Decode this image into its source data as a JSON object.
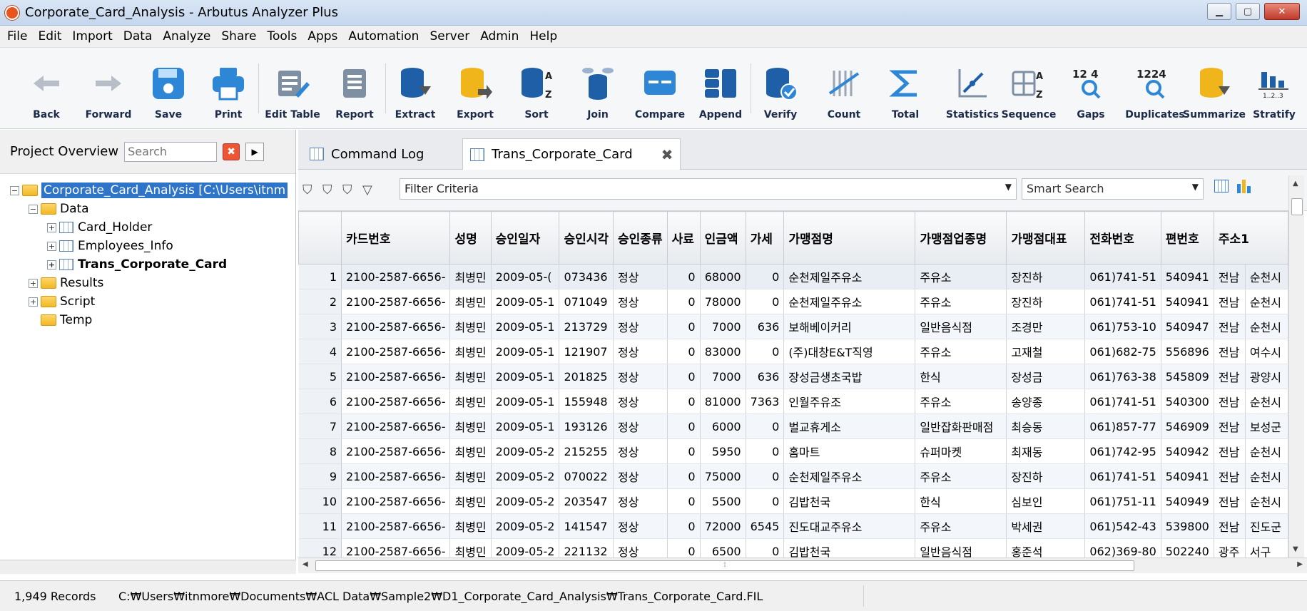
{
  "window": {
    "title": "Corporate_Card_Analysis - Arbutus Analyzer Plus"
  },
  "menu": [
    "File",
    "Edit",
    "Import",
    "Data",
    "Analyze",
    "Share",
    "Tools",
    "Apps",
    "Automation",
    "Server",
    "Admin",
    "Help"
  ],
  "toolbar": [
    "Back",
    "Forward",
    "Save",
    "Print",
    "Edit Table",
    "Report",
    "Extract",
    "Export",
    "Sort",
    "Join",
    "Compare",
    "Append",
    "Verify",
    "Count",
    "Total",
    "Statistics",
    "Sequence",
    "Gaps",
    "Duplicates",
    "Summarize",
    "Stratify"
  ],
  "toolbar_icon_text": {
    "gaps": "12 4",
    "duplicates": "1224",
    "stratify": "1..2..3",
    "sort_a": "A",
    "sort_z": "Z"
  },
  "project": {
    "title": "Project Overview",
    "search_placeholder": "Search",
    "root": "Corporate_Card_Analysis [C:\\Users\\itnm",
    "data": "Data",
    "tables": [
      "Card_Holder",
      "Employees_Info",
      "Trans_Corporate_Card"
    ],
    "folders": [
      "Results",
      "Script",
      "Temp"
    ]
  },
  "tabs": [
    "Command Log",
    "Trans_Corporate_Card"
  ],
  "filter": {
    "placeholder": "Filter Criteria",
    "smart_placeholder": "Smart Search"
  },
  "columns": [
    "카드번호",
    "성명",
    "승인일자",
    "승인시각",
    "승인종류",
    "사료",
    "인금액",
    "가세",
    "가맹점명",
    "가맹점업종명",
    "가맹점대표",
    "전화번호",
    "편번호",
    "주소1"
  ],
  "rows": [
    [
      "1",
      "2100-2587-6656-",
      "최병민",
      "2009-05-(",
      "073436",
      "정상",
      "0",
      "68000",
      "0",
      "순천제일주유소",
      "주유소",
      "장진하",
      "061)741-51",
      "540941",
      "전남",
      "순천시"
    ],
    [
      "2",
      "2100-2587-6656-",
      "최병민",
      "2009-05-1",
      "071049",
      "정상",
      "0",
      "78000",
      "0",
      "순천제일주유소",
      "주유소",
      "장진하",
      "061)741-51",
      "540941",
      "전남",
      "순천시"
    ],
    [
      "3",
      "2100-2587-6656-",
      "최병민",
      "2009-05-1",
      "213729",
      "정상",
      "0",
      "7000",
      "636",
      "보해베이커리",
      "일반음식점",
      "조경만",
      "061)753-10",
      "540947",
      "전남",
      "순천시"
    ],
    [
      "4",
      "2100-2587-6656-",
      "최병민",
      "2009-05-1",
      "121907",
      "정상",
      "0",
      "83000",
      "0",
      "(주)대창E&T직영",
      "주유소",
      "고재철",
      "061)682-75",
      "556896",
      "전남",
      "여수시"
    ],
    [
      "5",
      "2100-2587-6656-",
      "최병민",
      "2009-05-1",
      "201825",
      "정상",
      "0",
      "7000",
      "636",
      "장성금생초국밥",
      "한식",
      "장성금",
      "061)763-38",
      "545809",
      "전남",
      "광양시"
    ],
    [
      "6",
      "2100-2587-6656-",
      "최병민",
      "2009-05-1",
      "155948",
      "정상",
      "0",
      "81000",
      "7363",
      "인월주유조",
      "주유소",
      "송양종",
      "061)741-51",
      "540300",
      "전남",
      "순천시"
    ],
    [
      "7",
      "2100-2587-6656-",
      "최병민",
      "2009-05-1",
      "193126",
      "정상",
      "0",
      "6000",
      "0",
      "벌교휴게소",
      "일반잡화판매점",
      "최승동",
      "061)857-77",
      "546909",
      "전남",
      "보성군"
    ],
    [
      "8",
      "2100-2587-6656-",
      "최병민",
      "2009-05-2",
      "215255",
      "정상",
      "0",
      "5950",
      "0",
      "홈마트",
      "슈퍼마켓",
      "최재동",
      "061)742-95",
      "540942",
      "전남",
      "순천시"
    ],
    [
      "9",
      "2100-2587-6656-",
      "최병민",
      "2009-05-2",
      "070022",
      "정상",
      "0",
      "75000",
      "0",
      "순천제일주유소",
      "주유소",
      "장진하",
      "061)741-51",
      "540941",
      "전남",
      "순천시"
    ],
    [
      "10",
      "2100-2587-6656-",
      "최병민",
      "2009-05-2",
      "203547",
      "정상",
      "0",
      "5500",
      "0",
      "김밥천국",
      "한식",
      "심보인",
      "061)751-11",
      "540949",
      "전남",
      "순천시"
    ],
    [
      "11",
      "2100-2587-6656-",
      "최병민",
      "2009-05-2",
      "141547",
      "정상",
      "0",
      "72000",
      "6545",
      "진도대교주유소",
      "주유소",
      "박세권",
      "061)542-43",
      "539800",
      "전남",
      "진도군"
    ],
    [
      "12",
      "2100-2587-6656-",
      "최병민",
      "2009-05-2",
      "221132",
      "정상",
      "0",
      "6500",
      "0",
      "김밥천국",
      "일반음식점",
      "홍준석",
      "062)369-80",
      "502240",
      "광주",
      "서구"
    ]
  ],
  "status": {
    "records": "1,949 Records",
    "path": "C:₩Users₩itnmore₩Documents₩ACL Data₩Sample2₩D1_Corporate_Card_Analysis₩Trans_Corporate_Card.FIL"
  }
}
